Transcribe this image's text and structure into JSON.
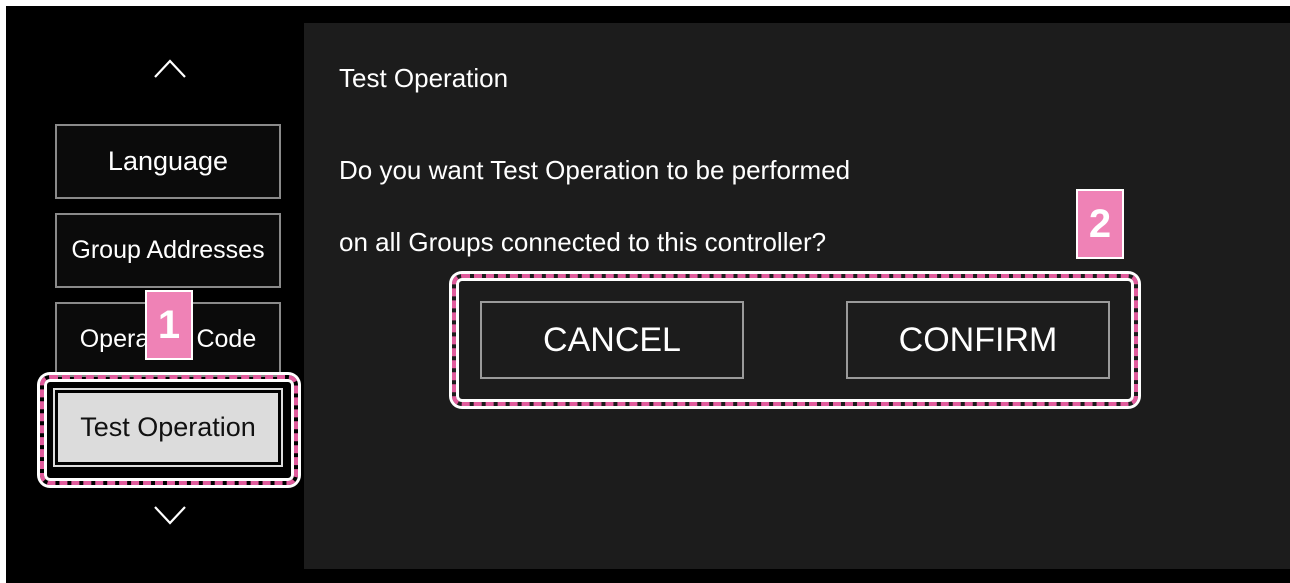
{
  "sidebar": {
    "items": [
      {
        "label": "Language"
      },
      {
        "label": "Group Addresses"
      },
      {
        "label": "Operation Code"
      },
      {
        "label": "Test Operation"
      }
    ],
    "selected_index": 3
  },
  "panel": {
    "title": "Test Operation",
    "message_line1": "Do you want Test Operation to be performed",
    "message_line2": "on all Groups connected to this controller?"
  },
  "buttons": {
    "cancel_label": "CANCEL",
    "confirm_label": "CONFIRM"
  },
  "callouts": {
    "step1": "1",
    "step2": "2"
  },
  "colors": {
    "highlight": "#e05b9c",
    "callout_fill": "#ef82b6",
    "panel_bg": "#1c1c1c",
    "selected_item_bg": "#dcdcdc"
  },
  "icons": {
    "scroll_up": "chevron-up-icon",
    "scroll_down": "chevron-down-icon"
  }
}
